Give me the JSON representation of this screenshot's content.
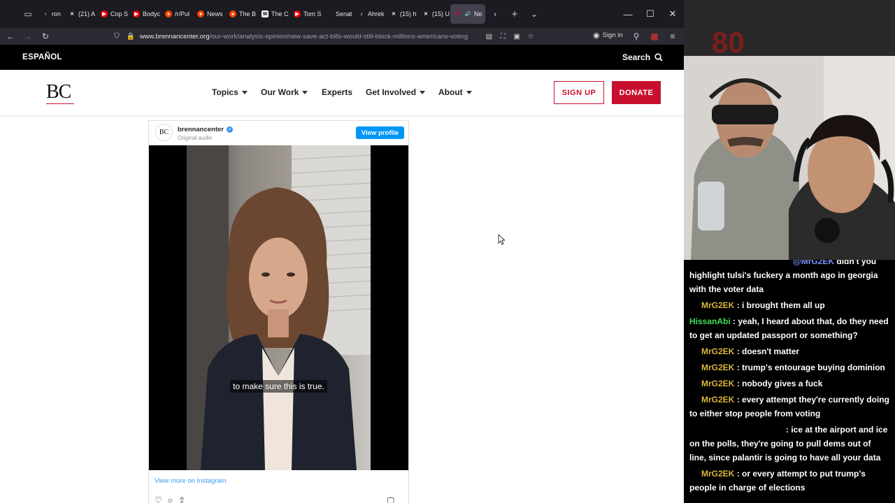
{
  "browser": {
    "tabs": [
      {
        "label": "ron",
        "icon": "chevron-left-icon",
        "color": "#1c1b22"
      },
      {
        "label": "(21) A",
        "icon": "x-logo-icon",
        "color": "#000000"
      },
      {
        "label": "Cop S",
        "icon": "youtube-icon",
        "color": "#ff0000"
      },
      {
        "label": "Bodyc",
        "icon": "youtube-icon",
        "color": "#ff0000"
      },
      {
        "label": "/r/Pul",
        "icon": "reddit-icon",
        "color": "#ff4500"
      },
      {
        "label": "News",
        "icon": "reddit-icon",
        "color": "#ff4500"
      },
      {
        "label": "The B",
        "icon": "reddit-icon",
        "color": "#ff4500"
      },
      {
        "label": "The C",
        "icon": "w-icon",
        "color": "#ffffff"
      },
      {
        "label": "Tom S",
        "icon": "youtube-icon",
        "color": "#ff0000"
      },
      {
        "label": "Senat",
        "icon": "blank-icon",
        "color": "#1c1b22"
      },
      {
        "label": "Ahrek",
        "icon": "tiktok-icon",
        "color": "#000000"
      },
      {
        "label": "(15) h",
        "icon": "x-logo-icon",
        "color": "#000000"
      },
      {
        "label": "(15) U",
        "icon": "x-logo-icon",
        "color": "#000000"
      },
      {
        "label": "Ne",
        "icon": "speaker-icon",
        "color": "#c8102e"
      }
    ],
    "url_domain": "www.brennancenter.org",
    "url_path": "/our-work/analysis-opinion/new-save-act-bills-would-still-block-millions-americans-voting",
    "signin_label": "Sign in"
  },
  "site": {
    "espanol": "ESPAÑOL",
    "search": "Search",
    "logo": "BC",
    "nav": [
      "Topics",
      "Our Work",
      "Experts",
      "Get Involved",
      "About"
    ],
    "signup": "SIGN UP",
    "donate": "DONATE",
    "brand_red": "#c8102e"
  },
  "embed": {
    "avatar": "BC",
    "username": "brennancenter",
    "audio": "Original audio",
    "view_profile": "View profile",
    "caption": "to make sure this is true.",
    "view_more": "View more on Instagram"
  },
  "chat": {
    "messages": [
      {
        "user": "",
        "text": "didn't you highlight tulsi's fuckery a month ago in georgia with the voter data",
        "mention": "@MrG2EK"
      },
      {
        "user": "MrG2EK",
        "text": ": i brought them all up"
      },
      {
        "user": "HissanAbi",
        "text": ": yeah, I heard about that, do they need to get an updated passport or something?",
        "host": true
      },
      {
        "user": "MrG2EK",
        "text": ": doesn't matter"
      },
      {
        "user": "MrG2EK",
        "text": ": trump's entourage buying dominion"
      },
      {
        "user": "MrG2EK",
        "text": ": nobody gives a fuck"
      },
      {
        "user": "MrG2EK",
        "text": ": every attempt they're currently doing to either stop people from voting"
      },
      {
        "user": "",
        "text": ": ice at the airport and ice on the polls, they're going to pull dems out of line, since palantir is going to have all your data"
      },
      {
        "user": "MrG2EK",
        "text": ": or every attempt to put trump's people in charge of elections"
      }
    ]
  }
}
